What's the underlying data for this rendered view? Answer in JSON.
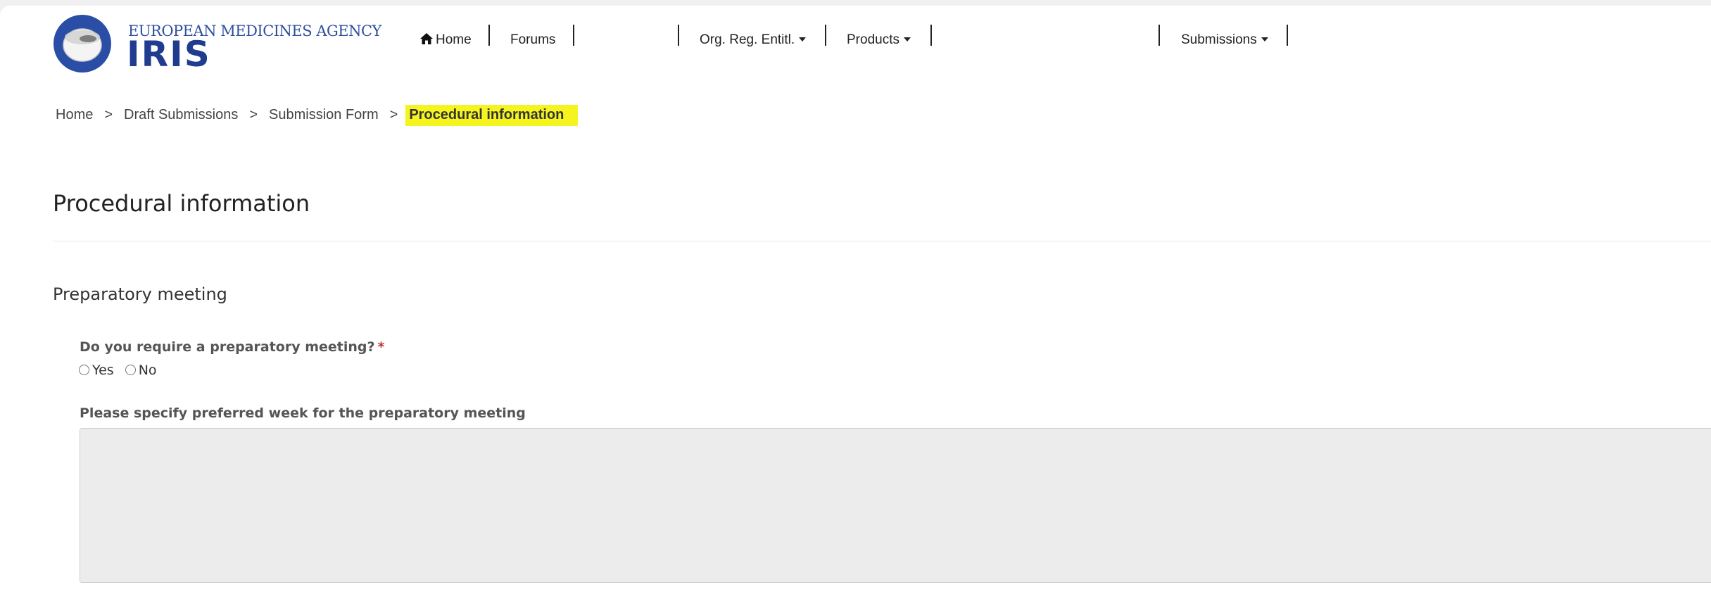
{
  "logo": {
    "agency_text": "EUROPEAN MEDICINES AGENCY",
    "product_text": "IRIS",
    "brand_color": "#1f3c8f"
  },
  "nav": {
    "home_icon": "home-icon",
    "home": "Home",
    "forums": "Forums",
    "org_reg": "Org. Reg. Entitl.",
    "products": "Products",
    "submissions": "Submissions"
  },
  "breadcrumb": {
    "home": "Home",
    "drafts": "Draft Submissions",
    "form": "Submission Form",
    "current": "Procedural information",
    "separator": ">",
    "highlight_color": "#f6f41e"
  },
  "page": {
    "title": "Procedural information",
    "section": "Preparatory meeting"
  },
  "form": {
    "question": "Do you require a preparatory meeting?",
    "required_mark": "*",
    "options": [
      "Yes",
      "No"
    ],
    "week_label": "Please specify preferred week for the preparatory meeting",
    "week_value": ""
  }
}
